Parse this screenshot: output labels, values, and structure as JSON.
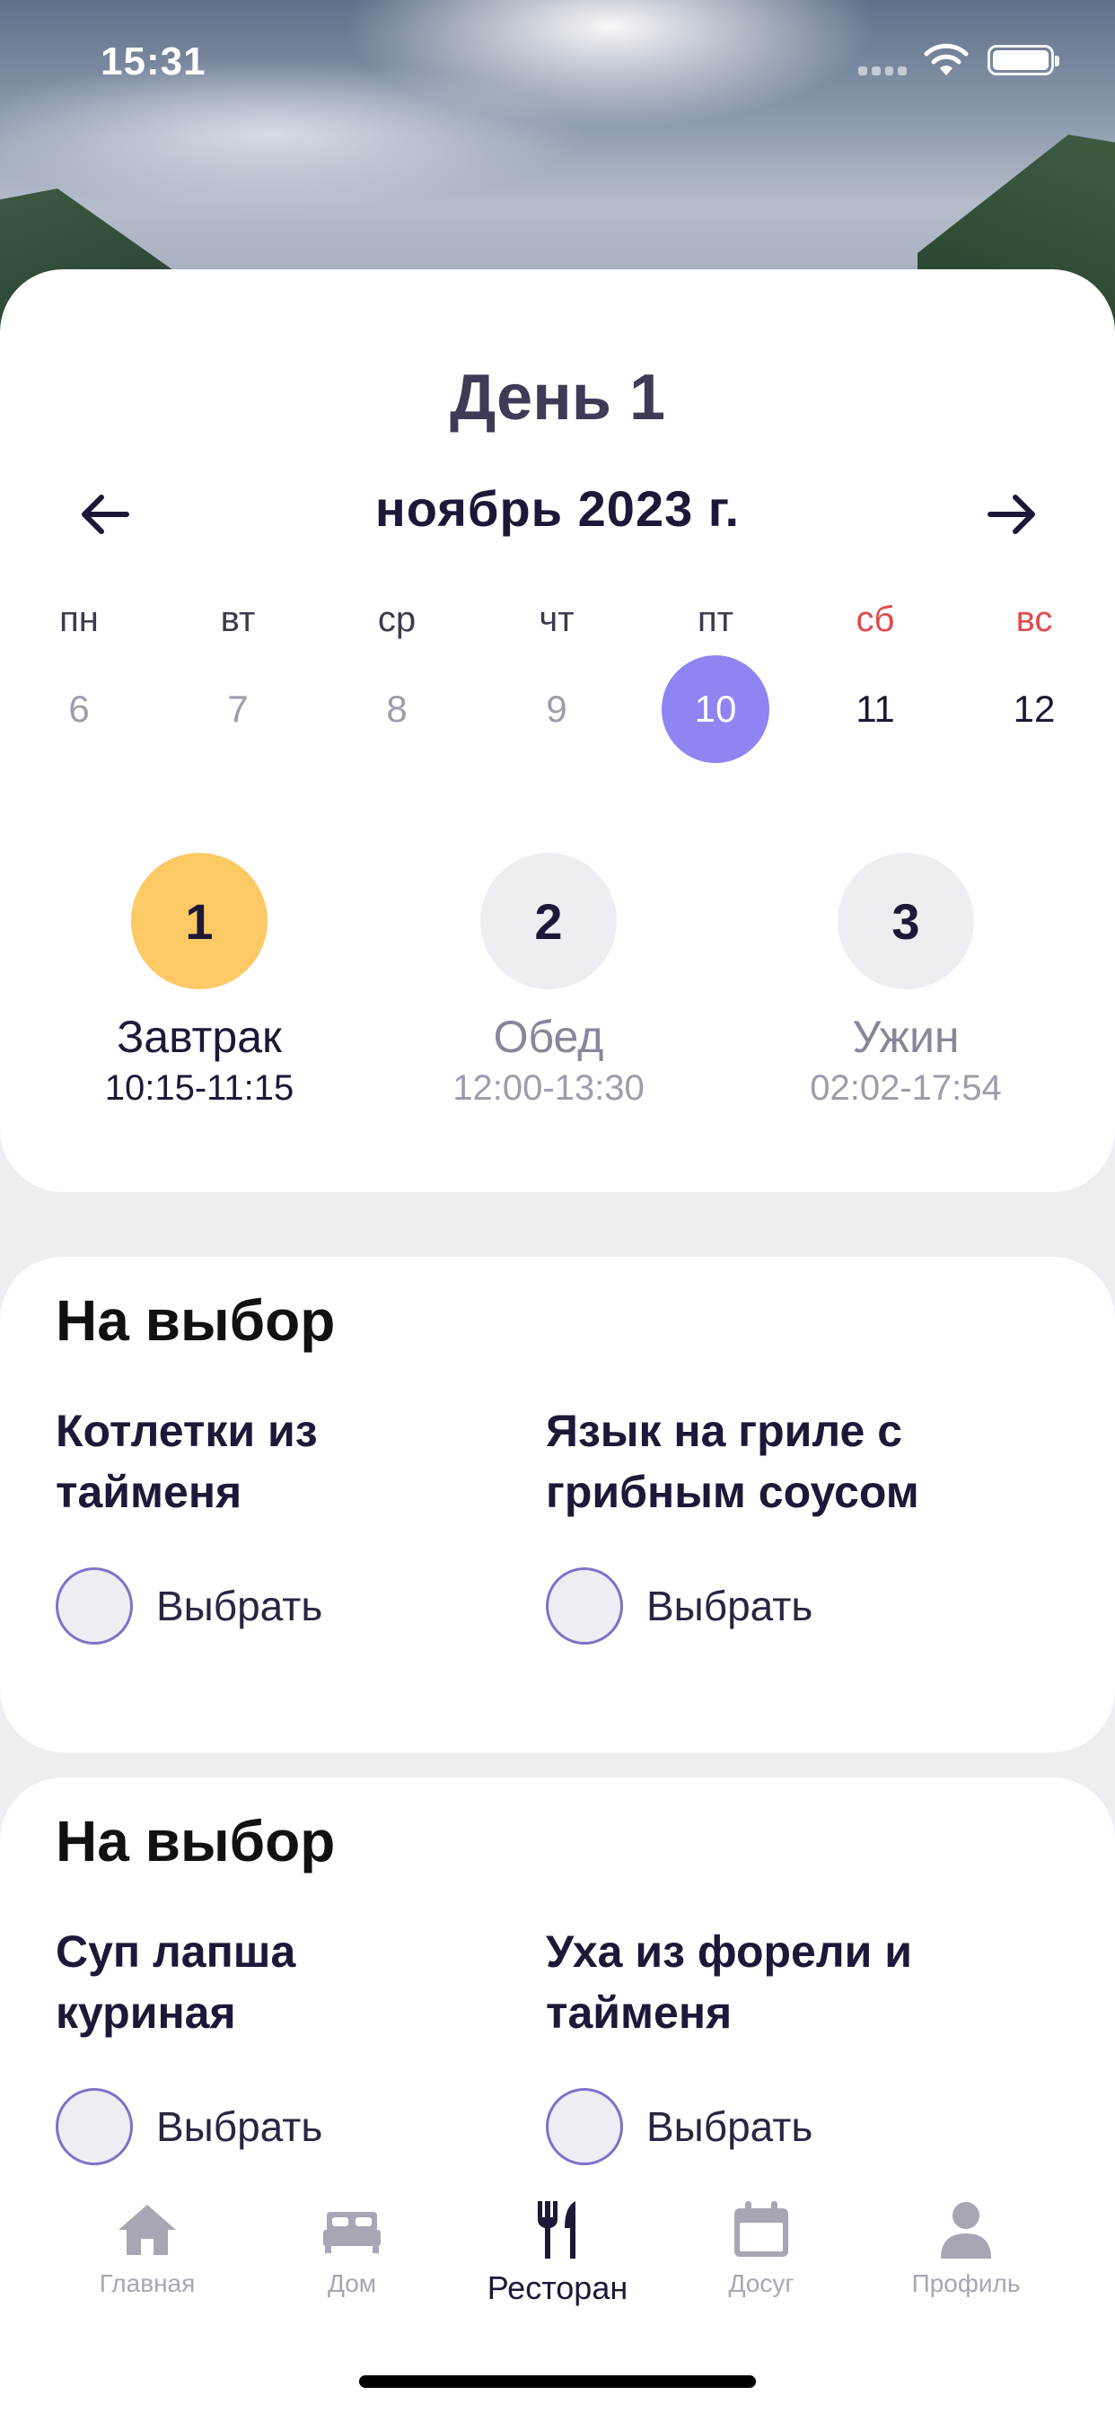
{
  "status_bar": {
    "time": "15:31"
  },
  "header": {
    "day_title": "День 1",
    "month": "ноябрь 2023 г."
  },
  "calendar": {
    "weekdays": [
      "пн",
      "вт",
      "ср",
      "чт",
      "пт",
      "сб",
      "вс"
    ],
    "dates": [
      "6",
      "7",
      "8",
      "9",
      "10",
      "11",
      "12"
    ],
    "selected_date": "10",
    "weekend_color": "#e04a4a",
    "selected_color": "#8f84f2"
  },
  "meals": [
    {
      "number": "1",
      "name": "Завтрак",
      "time": "10:15-11:15",
      "active": true
    },
    {
      "number": "2",
      "name": "Обед",
      "time": "12:00-13:30",
      "active": false
    },
    {
      "number": "3",
      "name": "Ужин",
      "time": "02:02-17:54",
      "active": false
    }
  ],
  "choice_groups": [
    {
      "title": "На выбор",
      "options": [
        {
          "name": "Котлетки из тайменя",
          "select_label": "Выбрать"
        },
        {
          "name": "Язык на гриле с грибным соусом",
          "select_label": "Выбрать"
        }
      ]
    },
    {
      "title": "На выбор",
      "options": [
        {
          "name": "Суп лапша куриная",
          "select_label": "Выбрать"
        },
        {
          "name": "Уха из форели и тайменя",
          "select_label": "Выбрать"
        }
      ]
    }
  ],
  "tab_bar": {
    "items": [
      {
        "label": "Главная",
        "icon": "home-icon"
      },
      {
        "label": "Дом",
        "icon": "bed-icon"
      },
      {
        "label": "Ресторан",
        "icon": "fork-knife-icon",
        "active": true
      },
      {
        "label": "Досуг",
        "icon": "calendar-icon"
      },
      {
        "label": "Профиль",
        "icon": "profile-icon"
      }
    ]
  },
  "colors": {
    "accent": "#8f84f2",
    "meal_active": "#fcc965",
    "text_dark": "#1e1838"
  }
}
